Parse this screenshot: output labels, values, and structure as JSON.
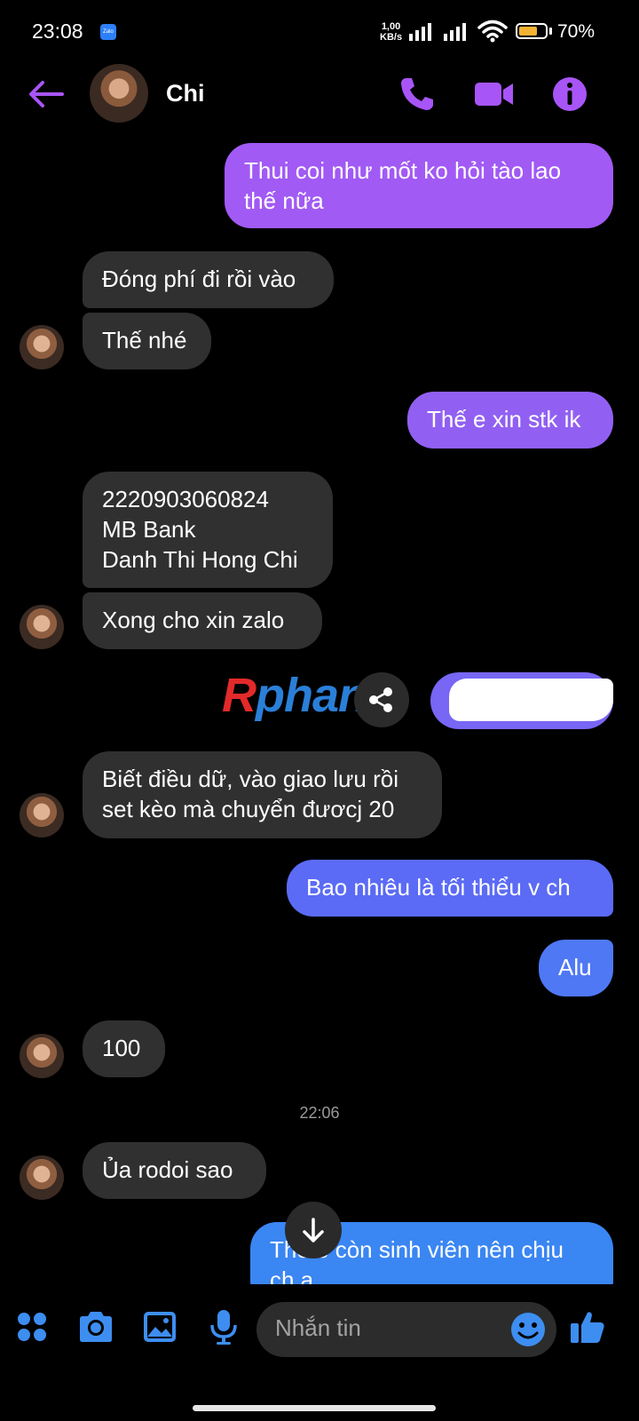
{
  "status_bar": {
    "time": "23:08",
    "app_badge": "Zalo",
    "net_speed_value": "1,00",
    "net_speed_unit": "KB/s",
    "battery_level": 0.7,
    "battery_text": "70%"
  },
  "header": {
    "contact_name": "Chi",
    "back_icon": "arrow-left-icon",
    "call_icon": "phone-icon",
    "video_icon": "video-icon",
    "info_icon": "info-icon"
  },
  "messages": [
    {
      "side": "sent",
      "text": "Thui coi như mốt ko hỏi tào lao\nthế nữa"
    },
    {
      "side": "recv",
      "text": "Đóng phí đi rồi vào"
    },
    {
      "side": "recv",
      "text": "Thế nhé"
    },
    {
      "side": "sent",
      "text": "Thế e xin stk ik"
    },
    {
      "side": "recv",
      "text": "2220903060824\nMB Bank\nDanh Thi Hong Chi"
    },
    {
      "side": "recv",
      "text": "Xong cho xin zalo"
    },
    {
      "side": "recv",
      "text": "Biết điều dữ, vào giao lưu rồi\nset kèo mà chuyển đươcj 20"
    },
    {
      "side": "sent",
      "text": "Bao nhiêu là tối thiểu v ch"
    },
    {
      "side": "sent",
      "text": "Alu"
    },
    {
      "side": "recv",
      "text": "100"
    },
    {
      "side": "recv",
      "text": "Ủa rodoi sao"
    },
    {
      "side": "sent",
      "text": "Thế e còn sinh viên nên chịu\nch a"
    }
  ],
  "timestamp_separator": "22:06",
  "watermark": {
    "part1": "R",
    "part2": "phang"
  },
  "composer": {
    "placeholder": "Nhắn tin",
    "icons": [
      "apps-icon",
      "camera-icon",
      "gallery-icon",
      "mic-icon",
      "emoji-icon",
      "like-icon"
    ]
  },
  "colors": {
    "accent_purple": "#a855f7",
    "bubble_purple": "#9b51f0",
    "bubble_blue": "#5b6bf5",
    "received_bubble": "#303030",
    "composer_blue": "#3d8ef0"
  }
}
